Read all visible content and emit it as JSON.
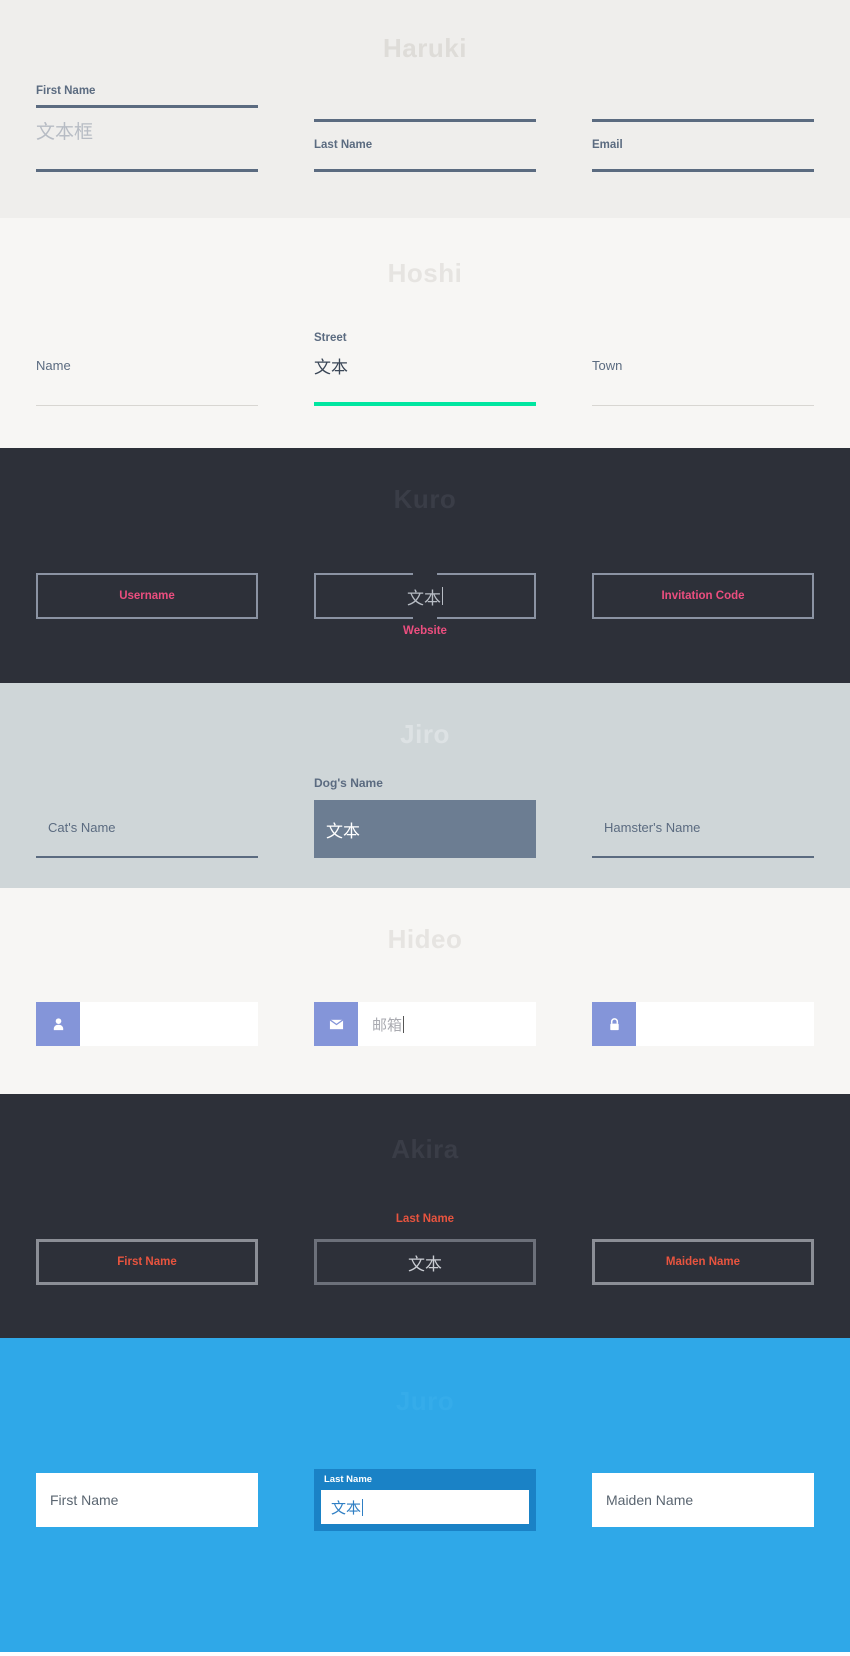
{
  "sections": [
    {
      "key": "haruki",
      "title": "Haruki",
      "fields": [
        {
          "label": "First Name",
          "value": "文本框",
          "state": "filled"
        },
        {
          "label": "Last Name",
          "value": "",
          "state": "empty"
        },
        {
          "label": "Email",
          "value": "",
          "state": "empty"
        }
      ]
    },
    {
      "key": "hoshi",
      "title": "Hoshi",
      "fields": [
        {
          "label": "Name",
          "value": "",
          "state": "empty"
        },
        {
          "label": "Street",
          "value": "文本",
          "state": "focused"
        },
        {
          "label": "Town",
          "value": "",
          "state": "empty"
        }
      ]
    },
    {
      "key": "kuro",
      "title": "Kuro",
      "fields": [
        {
          "label": "Username",
          "value": "",
          "state": "empty"
        },
        {
          "label": "Website",
          "value": "文本",
          "state": "focused"
        },
        {
          "label": "Invitation Code",
          "value": "",
          "state": "empty"
        }
      ]
    },
    {
      "key": "jiro",
      "title": "Jiro",
      "fields": [
        {
          "label": "Cat's Name",
          "value": "",
          "state": "empty"
        },
        {
          "label": "Dog's Name",
          "value": "文本",
          "state": "focused"
        },
        {
          "label": "Hamster's Name",
          "value": "",
          "state": "empty"
        }
      ]
    },
    {
      "key": "hideo",
      "title": "Hideo",
      "fields": [
        {
          "label": "",
          "value": "",
          "icon": "person-icon",
          "state": "empty"
        },
        {
          "label": "",
          "value": "邮箱",
          "icon": "envelope-icon",
          "state": "focused"
        },
        {
          "label": "",
          "value": "",
          "icon": "lock-icon",
          "state": "empty"
        }
      ]
    },
    {
      "key": "akira",
      "title": "Akira",
      "fields": [
        {
          "label": "First Name",
          "value": "",
          "state": "empty"
        },
        {
          "label": "Last Name",
          "value": "文本",
          "state": "focused"
        },
        {
          "label": "Maiden Name",
          "value": "",
          "state": "empty"
        }
      ]
    },
    {
      "key": "juro",
      "title": "Juro",
      "fields": [
        {
          "label": "First Name",
          "value": "",
          "state": "empty"
        },
        {
          "label": "Last Name",
          "value": "文本",
          "state": "focused"
        },
        {
          "label": "Maiden Name",
          "value": "",
          "state": "empty"
        }
      ]
    }
  ],
  "colors": {
    "haruki_bg": "#efeeec",
    "haruki_accent": "#5b6b80",
    "hoshi_bg": "#f7f6f4",
    "hoshi_accent": "#00e6a0",
    "kuro_bg": "#2d3039",
    "kuro_accent": "#ec4e7f",
    "jiro_bg": "#cfd6d8",
    "jiro_accent": "#6c7d92",
    "hideo_bg": "#f7f6f4",
    "hideo_accent": "#8495d9",
    "akira_bg": "#2d3039",
    "akira_accent": "#e8543f",
    "juro_bg": "#2fa8e8",
    "juro_accent": "#1a82c6"
  }
}
